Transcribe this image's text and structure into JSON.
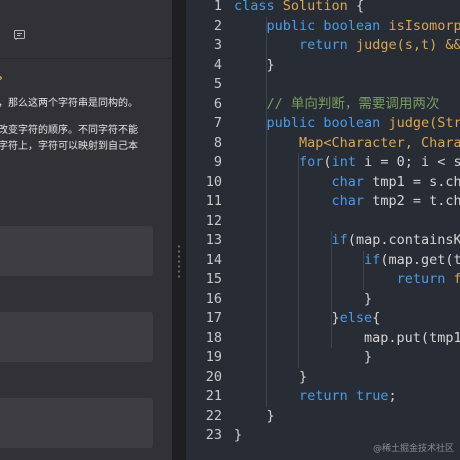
{
  "colors": {
    "keyword": "#4d9ae6",
    "class_name": "#d8a657",
    "comment": "#7a9d62",
    "plain": "#d4d4d4",
    "line_number": "#c8c8c8"
  },
  "left_panel": {
    "toolbar_icon": "note-icon",
    "description": [
      "。",
      "，那么这两个字符串是同构的。",
      "改变字符的顺序。不同字符不能",
      "字符上，字符可以映射到自己本"
    ]
  },
  "editor": {
    "line_numbers": [
      "1",
      "2",
      "3",
      "4",
      "5",
      "6",
      "7",
      "8",
      "9",
      "10",
      "11",
      "12",
      "13",
      "14",
      "15",
      "16",
      "17",
      "18",
      "19",
      "20",
      "21",
      "22",
      "23"
    ],
    "lines": [
      [
        {
          "t": "class ",
          "c": "keyword"
        },
        {
          "t": "Solution ",
          "c": "class_name"
        },
        {
          "t": "{",
          "c": "plain"
        }
      ],
      [
        {
          "t": "    ",
          "c": "plain"
        },
        {
          "t": "public boolean ",
          "c": "keyword"
        },
        {
          "t": "isIsomorp",
          "c": "class_name"
        }
      ],
      [
        {
          "t": "        ",
          "c": "plain"
        },
        {
          "t": "return ",
          "c": "keyword"
        },
        {
          "t": "judge(s,t) &&",
          "c": "class_name"
        }
      ],
      [
        {
          "t": "    }",
          "c": "plain"
        }
      ],
      [
        {
          "t": "",
          "c": "plain"
        }
      ],
      [
        {
          "t": "    ",
          "c": "plain"
        },
        {
          "t": "// 单向判断，需要调用两次",
          "c": "comment"
        }
      ],
      [
        {
          "t": "    ",
          "c": "plain"
        },
        {
          "t": "public boolean ",
          "c": "keyword"
        },
        {
          "t": "judge(Str",
          "c": "class_name"
        }
      ],
      [
        {
          "t": "        ",
          "c": "plain"
        },
        {
          "t": "Map<Character, Chara",
          "c": "class_name"
        }
      ],
      [
        {
          "t": "        ",
          "c": "plain"
        },
        {
          "t": "for",
          "c": "keyword"
        },
        {
          "t": "(",
          "c": "plain"
        },
        {
          "t": "int ",
          "c": "keyword"
        },
        {
          "t": "i = 0; i < s",
          "c": "plain"
        }
      ],
      [
        {
          "t": "            ",
          "c": "plain"
        },
        {
          "t": "char ",
          "c": "keyword"
        },
        {
          "t": "tmp1 = s.ch",
          "c": "plain"
        }
      ],
      [
        {
          "t": "            ",
          "c": "plain"
        },
        {
          "t": "char ",
          "c": "keyword"
        },
        {
          "t": "tmp2 = t.ch",
          "c": "plain"
        }
      ],
      [
        {
          "t": "",
          "c": "plain"
        }
      ],
      [
        {
          "t": "            ",
          "c": "plain"
        },
        {
          "t": "if",
          "c": "keyword"
        },
        {
          "t": "(map.containsK",
          "c": "plain"
        }
      ],
      [
        {
          "t": "                ",
          "c": "plain"
        },
        {
          "t": "if",
          "c": "keyword"
        },
        {
          "t": "(map.get(tm",
          "c": "plain"
        }
      ],
      [
        {
          "t": "                    ",
          "c": "plain"
        },
        {
          "t": "return ",
          "c": "keyword"
        },
        {
          "t": "f",
          "c": "class_name"
        }
      ],
      [
        {
          "t": "                }",
          "c": "plain"
        }
      ],
      [
        {
          "t": "            }",
          "c": "plain"
        },
        {
          "t": "else",
          "c": "keyword"
        },
        {
          "t": "{",
          "c": "plain"
        }
      ],
      [
        {
          "t": "                map.put(tmp1",
          "c": "plain"
        }
      ],
      [
        {
          "t": "                }",
          "c": "plain"
        }
      ],
      [
        {
          "t": "        }",
          "c": "plain"
        }
      ],
      [
        {
          "t": "        ",
          "c": "plain"
        },
        {
          "t": "return ",
          "c": "keyword"
        },
        {
          "t": "true",
          "c": "keyword"
        },
        {
          "t": ";",
          "c": "plain"
        }
      ],
      [
        {
          "t": "    }",
          "c": "plain"
        }
      ],
      [
        {
          "t": "}",
          "c": "plain"
        }
      ]
    ]
  },
  "watermark": "@稀土掘金技术社区"
}
